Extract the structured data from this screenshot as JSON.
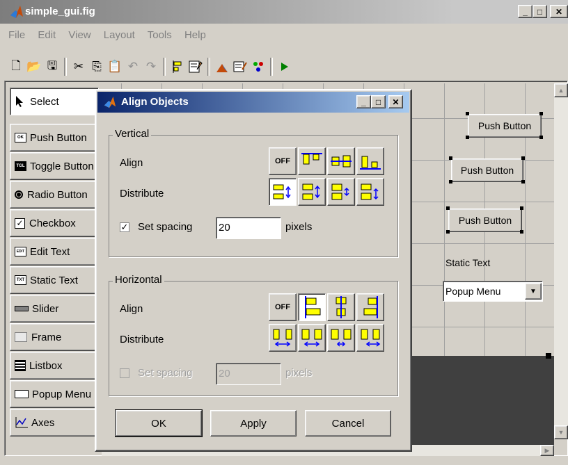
{
  "window": {
    "title": "simple_gui.fig"
  },
  "menu": [
    "File",
    "Edit",
    "View",
    "Layout",
    "Tools",
    "Help"
  ],
  "palette": [
    {
      "label": "Select",
      "icon": "arrow-cursor-icon"
    },
    {
      "label": "Push Button",
      "icon": "push-button-icon",
      "badge": "OK"
    },
    {
      "label": "Toggle Button",
      "icon": "toggle-button-icon",
      "badge": "TGL"
    },
    {
      "label": "Radio Button",
      "icon": "radio-button-icon"
    },
    {
      "label": "Checkbox",
      "icon": "checkbox-icon"
    },
    {
      "label": "Edit Text",
      "icon": "edit-text-icon",
      "badge": "EDIT"
    },
    {
      "label": "Static Text",
      "icon": "static-text-icon",
      "badge": "TXT"
    },
    {
      "label": "Slider",
      "icon": "slider-icon"
    },
    {
      "label": "Frame",
      "icon": "frame-icon"
    },
    {
      "label": "Listbox",
      "icon": "listbox-icon"
    },
    {
      "label": "Popup Menu",
      "icon": "popup-menu-icon"
    },
    {
      "label": "Axes",
      "icon": "axes-icon"
    }
  ],
  "canvas": {
    "buttons": [
      "Push Button",
      "Push Button",
      "Push Button"
    ],
    "static_text": "Static Text",
    "popup_value": "Popup Menu"
  },
  "dialog": {
    "title": "Align Objects",
    "vertical": {
      "label": "Vertical",
      "align_label": "Align",
      "distribute_label": "Distribute",
      "off_label": "OFF",
      "spacing_label": "Set spacing",
      "spacing_value": "20",
      "spacing_checked": true,
      "units": "pixels"
    },
    "horizontal": {
      "label": "Horizontal",
      "align_label": "Align",
      "distribute_label": "Distribute",
      "off_label": "OFF",
      "spacing_label": "Set spacing",
      "spacing_value": "20",
      "spacing_checked": false,
      "units": "pixels"
    },
    "buttons": {
      "ok": "OK",
      "apply": "Apply",
      "cancel": "Cancel"
    }
  },
  "colors": {
    "face": "#d4d0c8",
    "title_active": "#0a246a",
    "icon_yellow": "#ffff00",
    "icon_blue": "#0000ff"
  }
}
